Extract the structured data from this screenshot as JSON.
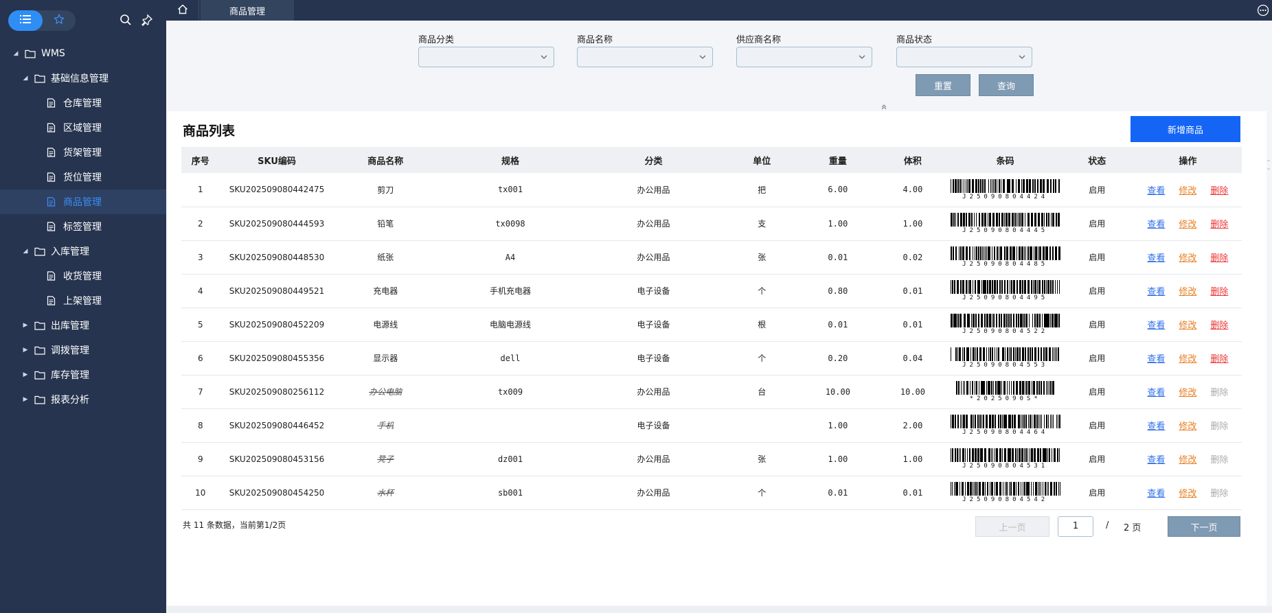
{
  "colors": {
    "sidebar_bg": "#26344f",
    "accent": "#1465f5",
    "active_text": "#3b8ef2",
    "view": "#2f6fe8",
    "edit": "#e77d1f",
    "delete": "#e33333",
    "disabled": "#aaaaaa"
  },
  "sidebar": {
    "tabs": [
      {
        "icon": "list-icon"
      },
      {
        "icon": "star-icon"
      }
    ],
    "tools": [
      {
        "icon": "search-icon"
      },
      {
        "icon": "pin-icon"
      }
    ],
    "tree": [
      {
        "label": "WMS",
        "level": 0,
        "expanded": true,
        "type": "folder"
      },
      {
        "label": "基础信息管理",
        "level": 1,
        "expanded": true,
        "type": "folder"
      },
      {
        "label": "仓库管理",
        "level": 2,
        "type": "file"
      },
      {
        "label": "区域管理",
        "level": 2,
        "type": "file"
      },
      {
        "label": "货架管理",
        "level": 2,
        "type": "file"
      },
      {
        "label": "货位管理",
        "level": 2,
        "type": "file"
      },
      {
        "label": "商品管理",
        "level": 2,
        "type": "file",
        "active": true
      },
      {
        "label": "标签管理",
        "level": 2,
        "type": "file"
      },
      {
        "label": "入库管理",
        "level": 1,
        "expanded": true,
        "type": "folder"
      },
      {
        "label": "收货管理",
        "level": 2,
        "type": "file"
      },
      {
        "label": "上架管理",
        "level": 2,
        "type": "file"
      },
      {
        "label": "出库管理",
        "level": 1,
        "expanded": false,
        "type": "folder"
      },
      {
        "label": "调拨管理",
        "level": 1,
        "expanded": false,
        "type": "folder"
      },
      {
        "label": "库存管理",
        "level": 1,
        "expanded": false,
        "type": "folder"
      },
      {
        "label": "报表分析",
        "level": 1,
        "expanded": false,
        "type": "folder"
      }
    ]
  },
  "topbar": {
    "home_icon": "home-icon",
    "tab_label": "商品管理",
    "more_icon": "more-icon"
  },
  "filter": {
    "fields": [
      {
        "label": "商品分类",
        "value": ""
      },
      {
        "label": "商品名称",
        "value": ""
      },
      {
        "label": "供应商名称",
        "value": ""
      },
      {
        "label": "商品状态",
        "value": ""
      }
    ],
    "reset_label": "重置",
    "search_label": "查询"
  },
  "list": {
    "title": "商品列表",
    "add_label": "新增商品",
    "columns": [
      "序号",
      "SKU编码",
      "商品名称",
      "规格",
      "分类",
      "单位",
      "重量",
      "体积",
      "条码",
      "状态",
      "操作"
    ],
    "action_labels": {
      "view": "查看",
      "edit": "修改",
      "delete": "删除"
    },
    "rows": [
      {
        "no": "1",
        "sku": "SKU202509080442475",
        "name": "剪刀",
        "spec": "tx001",
        "category": "办公用品",
        "unit": "把",
        "weight": "6.00",
        "volume": "4.00",
        "barcode": "J25090804424",
        "status": "启用",
        "deleted": false
      },
      {
        "no": "2",
        "sku": "SKU202509080444593",
        "name": "铅笔",
        "spec": "tx0098",
        "category": "办公用品",
        "unit": "支",
        "weight": "1.00",
        "volume": "1.00",
        "barcode": "J25090804445",
        "status": "启用",
        "deleted": false
      },
      {
        "no": "3",
        "sku": "SKU202509080448530",
        "name": "纸张",
        "spec": "A4",
        "category": "办公用品",
        "unit": "张",
        "weight": "0.01",
        "volume": "0.02",
        "barcode": "J25090804485",
        "status": "启用",
        "deleted": false
      },
      {
        "no": "4",
        "sku": "SKU202509080449521",
        "name": "充电器",
        "spec": "手机充电器",
        "category": "电子设备",
        "unit": "个",
        "weight": "0.80",
        "volume": "0.01",
        "barcode": "J25090804495",
        "status": "启用",
        "deleted": false
      },
      {
        "no": "5",
        "sku": "SKU202509080452209",
        "name": "电源线",
        "spec": "电脑电源线",
        "category": "电子设备",
        "unit": "根",
        "weight": "0.01",
        "volume": "0.01",
        "barcode": "J25090804522",
        "status": "启用",
        "deleted": false
      },
      {
        "no": "6",
        "sku": "SKU202509080455356",
        "name": "显示器",
        "spec": "dell",
        "category": "电子设备",
        "unit": "个",
        "weight": "0.20",
        "volume": "0.04",
        "barcode": "J25090804553",
        "status": "启用",
        "deleted": false
      },
      {
        "no": "7",
        "sku": "SKU202509080256112",
        "name": "办公电脑",
        "spec": "tx009",
        "category": "办公用品",
        "unit": "台",
        "weight": "10.00",
        "volume": "10.00",
        "barcode": "*2025090S*",
        "status": "启用",
        "deleted": true
      },
      {
        "no": "8",
        "sku": "SKU202509080446452",
        "name": "手机",
        "spec": "",
        "category": "电子设备",
        "unit": "",
        "weight": "1.00",
        "volume": "2.00",
        "barcode": "J25090804464",
        "status": "启用",
        "deleted": true
      },
      {
        "no": "9",
        "sku": "SKU202509080453156",
        "name": "凳子",
        "spec": "dz001",
        "category": "办公用品",
        "unit": "张",
        "weight": "1.00",
        "volume": "1.00",
        "barcode": "J25090804531",
        "status": "启用",
        "deleted": true
      },
      {
        "no": "10",
        "sku": "SKU202509080454250",
        "name": "水杯",
        "spec": "sb001",
        "category": "办公用品",
        "unit": "个",
        "weight": "0.01",
        "volume": "0.01",
        "barcode": "J25090804542",
        "status": "启用",
        "deleted": true
      }
    ]
  },
  "pagination": {
    "info": "共 11 条数据，当前第1/2页",
    "prev_label": "上一页",
    "current": "1",
    "separator": "/",
    "total_label": "2 页",
    "next_label": "下一页"
  }
}
